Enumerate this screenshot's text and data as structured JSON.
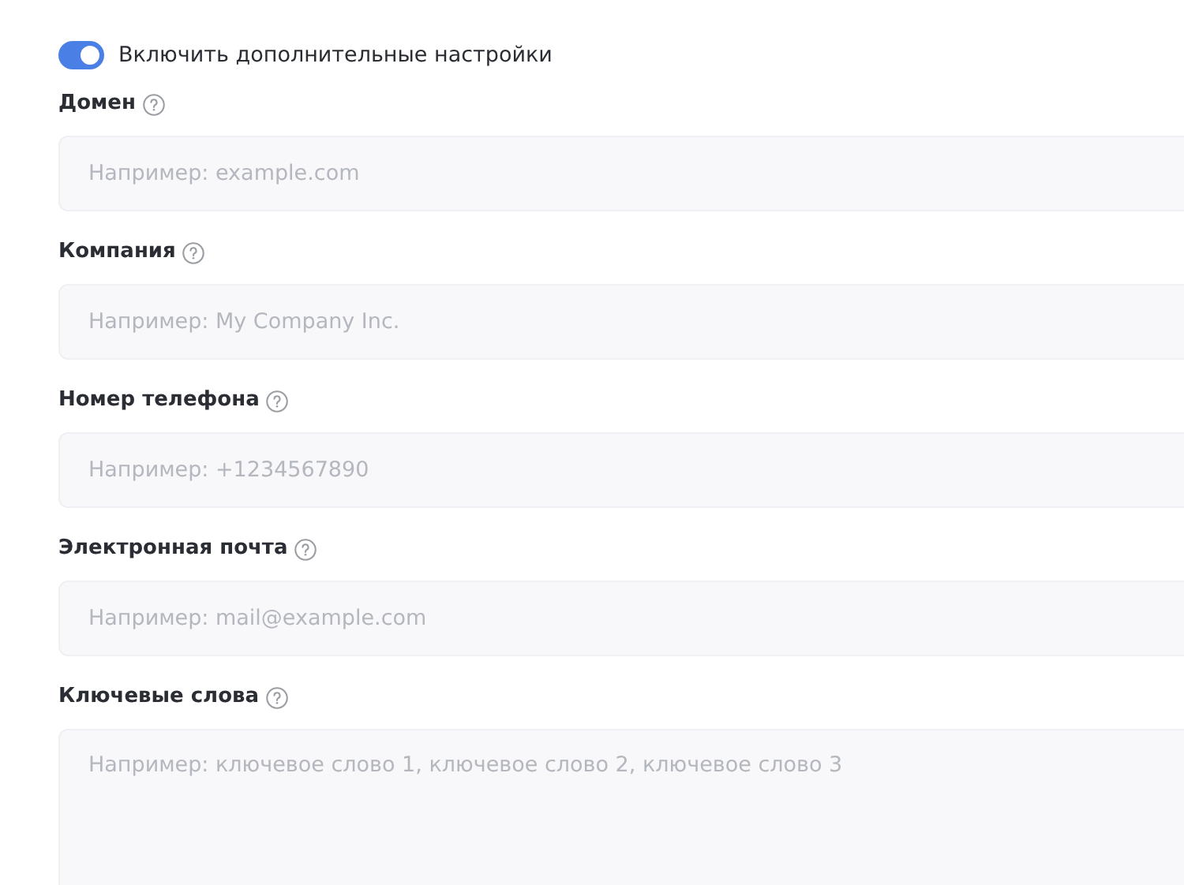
{
  "toggle": {
    "label": "Включить дополнительные настройки",
    "on": true
  },
  "fields": [
    {
      "kind": "input",
      "label": "Домен",
      "placeholder": "Например: example.com"
    },
    {
      "kind": "input",
      "label": "Компания",
      "placeholder": "Например: My Company Inc."
    },
    {
      "kind": "input",
      "label": "Номер телефона",
      "placeholder": "Например: +1234567890"
    },
    {
      "kind": "input",
      "label": "Электронная почта",
      "placeholder": "Например: mail@example.com"
    },
    {
      "kind": "textarea",
      "label": "Ключевые слова",
      "placeholder": "Например: ключевое слово 1, ключевое слово 2, ключевое слово 3"
    }
  ]
}
